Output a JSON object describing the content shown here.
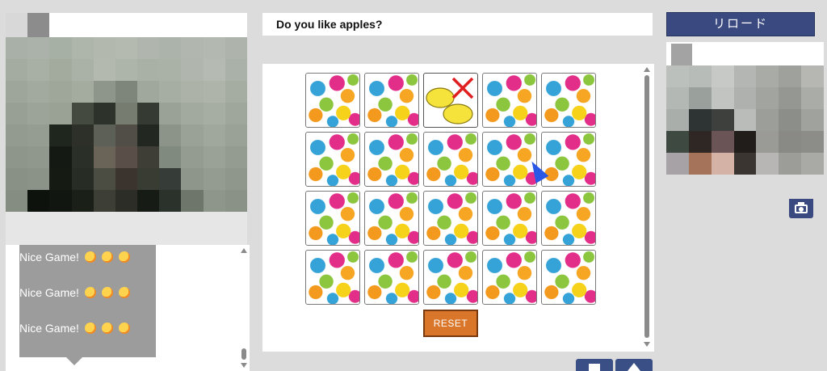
{
  "question": {
    "text": "Do you like apples?"
  },
  "chat": {
    "messages": [
      {
        "text": "Nice Game!"
      },
      {
        "text": "Nice Game!"
      },
      {
        "text": "Nice Game!"
      }
    ]
  },
  "game": {
    "reset_label": "RESET",
    "grid": {
      "rows": 4,
      "cols": 5
    },
    "cards": [
      "back",
      "back",
      "lemons",
      "back",
      "back",
      "back",
      "back",
      "back",
      "back",
      "back",
      "back",
      "back",
      "back",
      "back",
      "back",
      "back",
      "back",
      "back",
      "back",
      "back"
    ]
  },
  "reload_label": "リロード",
  "colors": {
    "accent_blue": "#3a4a80",
    "reset_orange": "#d9762a",
    "chat_bubble": "#9c9c9c"
  },
  "cam_left_pixels": [
    "#a9b0a8",
    "#abb2a9",
    "#a7b0a5",
    "#aeb5ab",
    "#b2b8ae",
    "#b4bab0",
    "#b0b6ad",
    "#acb3aa",
    "#b1b7ae",
    "#b3b9b0",
    "#aeb4ab",
    "#a4aca2",
    "#a8b0a5",
    "#a3ab9f",
    "#aab1a6",
    "#b3b9ae",
    "#adb4a9",
    "#a9b0a6",
    "#aab1a7",
    "#b0b6ad",
    "#b5bbb2",
    "#aab1a8",
    "#9ea69c",
    "#a2aa9f",
    "#9fa79b",
    "#a4ab9f",
    "#8e958a",
    "#7e857a",
    "#a0a79c",
    "#a6ada2",
    "#acb2a8",
    "#aeb4aa",
    "#a5aca1",
    "#98a096",
    "#9ca499",
    "#9aa296",
    "#444a40",
    "#2d322a",
    "#777c70",
    "#353b32",
    "#9aa197",
    "#a2a99e",
    "#a6ada3",
    "#9fa69b",
    "#939b90",
    "#959d92",
    "#1f261e",
    "#2c3028",
    "#5d6056",
    "#504e47",
    "#222722",
    "#8c9489",
    "#9aa196",
    "#a0a79c",
    "#9aa196",
    "#8e968b",
    "#90988d",
    "#141a13",
    "#2a2f27",
    "#6a6358",
    "#5a4e48",
    "#3e3d36",
    "#818a7f",
    "#949b90",
    "#9aa196",
    "#949b90",
    "#899186",
    "#8b9388",
    "#151a13",
    "#272c24",
    "#4c4d42",
    "#3b332d",
    "#383c33",
    "#363d38",
    "#8e958b",
    "#949b90",
    "#8f968b",
    "#858d82",
    "#0d120c",
    "#111710",
    "#1a1f18",
    "#3d3f36",
    "#2b2d26",
    "#161b15",
    "#2b312b",
    "#6e766c",
    "#8e958a",
    "#8a9186"
  ],
  "cam_right_pixels": [
    "#bcc0bd",
    "#b8bcb9",
    "#c7c9c6",
    "#b3b6b2",
    "#a8aba6",
    "#9fa19c",
    "#b6b7b3",
    "#b4b8b5",
    "#9aa09c",
    "#c1c4c1",
    "#aeb1ad",
    "#a2a4a0",
    "#959792",
    "#aaaca8",
    "#a9aeab",
    "#2e3433",
    "#3d403d",
    "#b9bcb9",
    "#9c9e99",
    "#8c8e89",
    "#a0a29e",
    "#3e4a41",
    "#2e2724",
    "#6a5456",
    "#211d1b",
    "#9a9a96",
    "#898a86",
    "#8c8d89",
    "#a6a2a6",
    "#a5735a",
    "#d5b2a6",
    "#3a3531",
    "#b7b6b4",
    "#9c9c98",
    "#a9a9a5"
  ]
}
